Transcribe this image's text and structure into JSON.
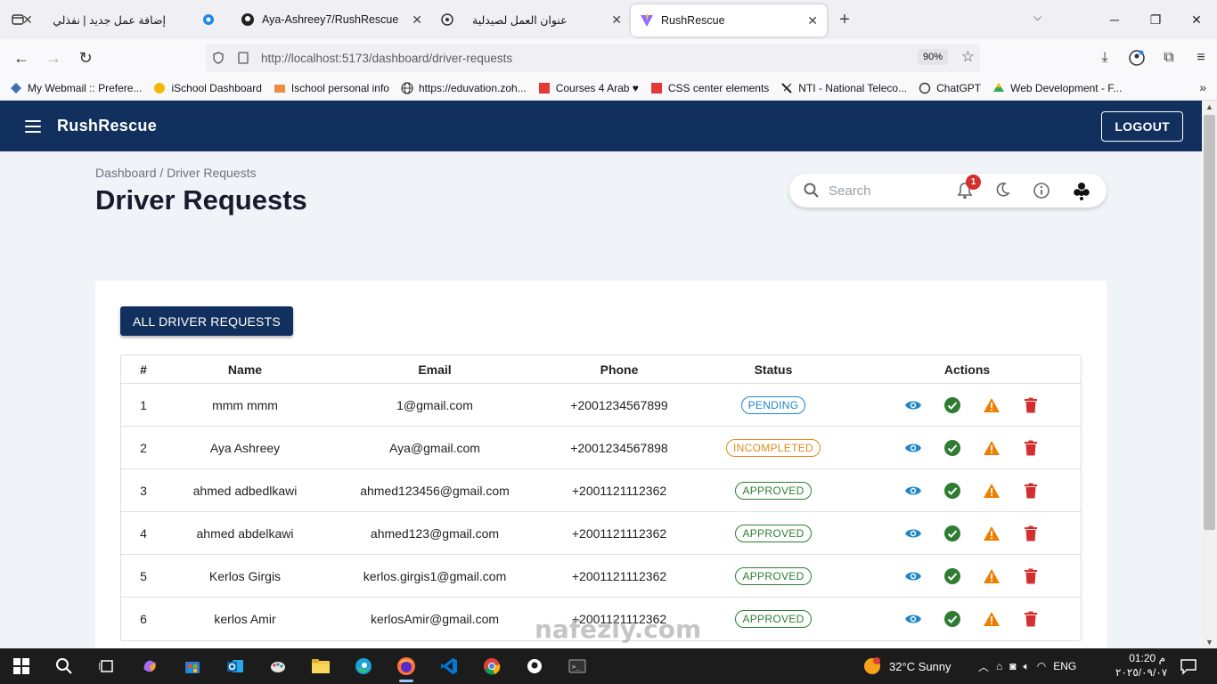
{
  "browser": {
    "tabs": [
      {
        "title": "إضافة عمل جديد | نفذلي",
        "icon": "nafezly-icon",
        "active": false
      },
      {
        "title": "Aya-Ashreey7/RushRescue",
        "icon": "github-icon",
        "active": false
      },
      {
        "title": "عنوان العمل لصيدلية",
        "icon": "chatgpt-icon",
        "active": false
      },
      {
        "title": "RushRescue",
        "icon": "vite-icon",
        "active": true
      }
    ],
    "url_host": "http://localhost",
    "url_path": ":5173/dashboard/driver-requests",
    "zoom": "90%",
    "bookmarks": [
      {
        "label": "My Webmail :: Prefere..."
      },
      {
        "label": "iSchool Dashboard"
      },
      {
        "label": "Ischool personal info"
      },
      {
        "label": "https://eduvation.zoh..."
      },
      {
        "label": "Courses 4 Arab ♥"
      },
      {
        "label": "CSS center elements"
      },
      {
        "label": "NTI - National Teleco..."
      },
      {
        "label": "ChatGPT"
      },
      {
        "label": "Web Development - F..."
      }
    ]
  },
  "app": {
    "brand": "RushRescue",
    "logout_label": "LOGOUT",
    "breadcrumb": "Dashboard / Driver Requests",
    "title": "Driver Requests",
    "search_placeholder": "Search",
    "notification_count": "1",
    "all_requests_label": "ALL DRIVER REQUESTS",
    "columns": {
      "num": "#",
      "name": "Name",
      "email": "Email",
      "phone": "Phone",
      "status": "Status",
      "actions": "Actions"
    },
    "rows": [
      {
        "num": "1",
        "name": "mmm mmm",
        "email": "1@gmail.com",
        "phone": "+2001234567899",
        "status": "PENDING"
      },
      {
        "num": "2",
        "name": "Aya Ashreey",
        "email": "Aya@gmail.com",
        "phone": "+2001234567898",
        "status": "INCOMPLETED"
      },
      {
        "num": "3",
        "name": "ahmed adbedlkawi",
        "email": "ahmed123456@gmail.com",
        "phone": "+2001121112362",
        "status": "APPROVED"
      },
      {
        "num": "4",
        "name": "ahmed abdelkawi",
        "email": "ahmed123@gmail.com",
        "phone": "+2001121112362",
        "status": "APPROVED"
      },
      {
        "num": "5",
        "name": "Kerlos Girgis",
        "email": "kerlos.girgis1@gmail.com",
        "phone": "+2001121112362",
        "status": "APPROVED"
      },
      {
        "num": "6",
        "name": "kerlos Amir",
        "email": "kerlosAmir@gmail.com",
        "phone": "+2001121112362",
        "status": "APPROVED"
      }
    ],
    "status_colors": {
      "PENDING": "#1e88c7",
      "INCOMPLETED": "#e08a1e",
      "APPROVED": "#2e7d32"
    },
    "colors": {
      "header": "#12305e",
      "view": "#1e88c7",
      "approve": "#2e7d32",
      "warn": "#ef7d00",
      "delete": "#d32f2f"
    }
  },
  "taskbar": {
    "weather": "32°C  Sunny",
    "lang": "ENG",
    "time": "01:20 م",
    "date": "٢٠٢٥/٠٩/٠٧"
  },
  "watermark": "nafezly.com"
}
